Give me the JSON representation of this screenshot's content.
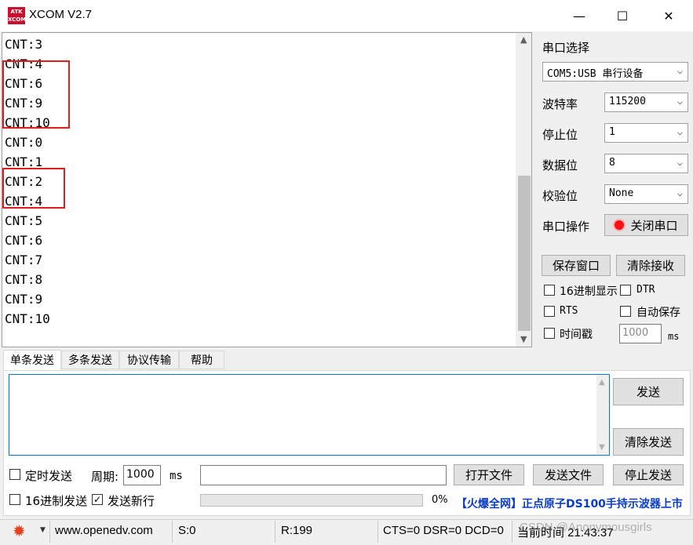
{
  "window": {
    "title": "XCOM V2.7",
    "logo_text_top": "ATK",
    "logo_text_bottom": "XCOM",
    "minimize": "—",
    "maximize": "☐",
    "close": "✕"
  },
  "receive": {
    "lines": [
      "CNT:3",
      "CNT:4",
      "CNT:6",
      "CNT:9",
      "CNT:10",
      "CNT:0",
      "CNT:1",
      "CNT:2",
      "CNT:4",
      "CNT:5",
      "CNT:6",
      "CNT:7",
      "CNT:8",
      "CNT:9",
      "CNT:10"
    ]
  },
  "panel": {
    "port_select_label": "串口选择",
    "port_value": "COM5:USB 串行设备",
    "baud_label": "波特率",
    "baud_value": "115200",
    "stop_label": "停止位",
    "stop_value": "1",
    "data_label": "数据位",
    "data_value": "8",
    "parity_label": "校验位",
    "parity_value": "None",
    "op_label": "串口操作",
    "close_port": "关闭串口",
    "save_window": "保存窗口",
    "clear_recv": "清除接收",
    "hex_display": "16进制显示",
    "dtr": "DTR",
    "rts": "RTS",
    "auto_save": "自动保存",
    "timestamp": "时间戳",
    "timestamp_value": "1000",
    "ms": "ms"
  },
  "tabs": [
    "单条发送",
    "多条发送",
    "协议传输",
    "帮助"
  ],
  "send": {
    "send_button": "发送",
    "clear_send": "清除发送",
    "timed_send": "定时发送",
    "period_label": "周期:",
    "period_value": "1000",
    "ms": "ms",
    "open_file": "打开文件",
    "send_file": "发送文件",
    "stop_send": "停止发送",
    "hex_send": "16进制发送",
    "send_newline": "发送新行",
    "progress": "0%",
    "ad": "【火爆全网】正点原子DS100手持示波器上市"
  },
  "statusbar": {
    "url": "www.openedv.com",
    "s": "S:0",
    "r": "R:199",
    "signals": "CTS=0 DSR=0 DCD=0",
    "time": "当前时间 21:43:37",
    "watermark": "CSDN @Anonymousgirls"
  }
}
